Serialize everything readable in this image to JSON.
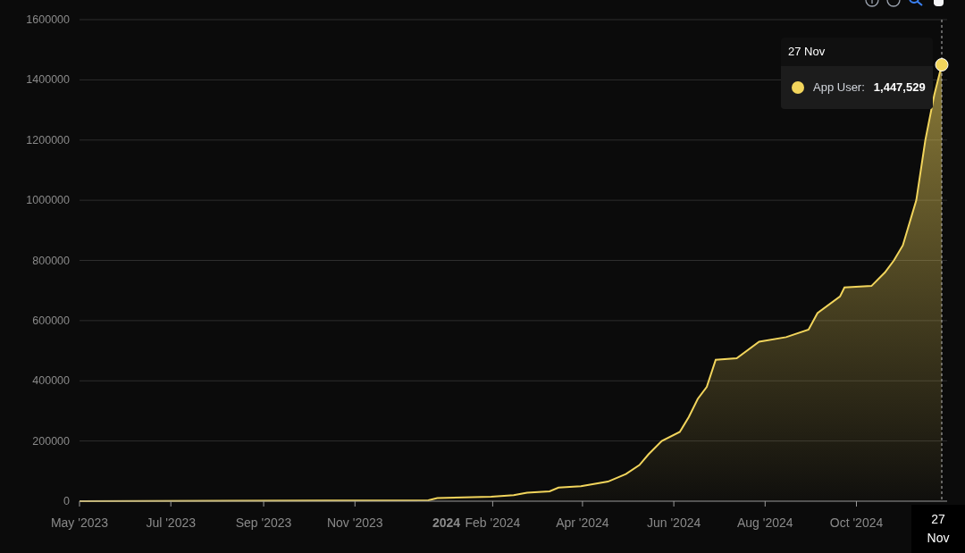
{
  "chart": {
    "chart_data": {
      "type": "area",
      "grid": true,
      "xlim": [
        "2023-05-01",
        "2024-11-27"
      ],
      "ylim": [
        0,
        1600000
      ],
      "x": [
        "2023-05-01",
        "2023-12-20",
        "2023-12-26",
        "2024-01-31",
        "2024-02-15",
        "2024-02-24",
        "2024-03-10",
        "2024-03-16",
        "2024-03-31",
        "2024-04-18",
        "2024-04-30",
        "2024-05-09",
        "2024-05-15",
        "2024-05-24",
        "2024-06-05",
        "2024-06-11",
        "2024-06-17",
        "2024-06-23",
        "2024-06-29",
        "2024-07-13",
        "2024-07-28",
        "2024-08-15",
        "2024-08-30",
        "2024-09-05",
        "2024-09-20",
        "2024-09-23",
        "2024-10-11",
        "2024-10-20",
        "2024-10-26",
        "2024-11-01",
        "2024-11-10",
        "2024-11-16",
        "2024-11-22",
        "2024-11-27"
      ],
      "series": [
        {
          "name": "App User",
          "color": "#f2d55c",
          "values": [
            0,
            3000,
            10000,
            15000,
            20000,
            28000,
            33000,
            45000,
            50000,
            65000,
            90000,
            120000,
            155000,
            200000,
            230000,
            280000,
            340000,
            380000,
            470000,
            475000,
            530000,
            545000,
            570000,
            625000,
            680000,
            710000,
            715000,
            760000,
            800000,
            850000,
            1000000,
            1200000,
            1350000,
            1450000
          ]
        }
      ],
      "yticks": [
        0,
        200000,
        400000,
        600000,
        800000,
        1000000,
        1200000,
        1400000,
        1600000
      ],
      "xticks": [
        {
          "value": "2023-05-01",
          "label": "May '2023"
        },
        {
          "value": "2023-07-01",
          "label": "Jul '2023"
        },
        {
          "value": "2023-09-01",
          "label": "Sep '2023"
        },
        {
          "value": "2023-11-01",
          "label": "Nov '2023"
        },
        {
          "value": "2024-01-01",
          "label": "2024"
        },
        {
          "value": "2024-02-01",
          "label": "Feb '2024"
        },
        {
          "value": "2024-04-01",
          "label": "Apr '2024"
        },
        {
          "value": "2024-06-01",
          "label": "Jun '2024"
        },
        {
          "value": "2024-08-01",
          "label": "Aug '2024"
        },
        {
          "value": "2024-10-01",
          "label": "Oct '2024"
        }
      ]
    },
    "crosshair": {
      "label": "27 Nov"
    },
    "tooltip": {
      "title": "27 Nov",
      "separator": ":",
      "value": "1,447,529"
    }
  }
}
